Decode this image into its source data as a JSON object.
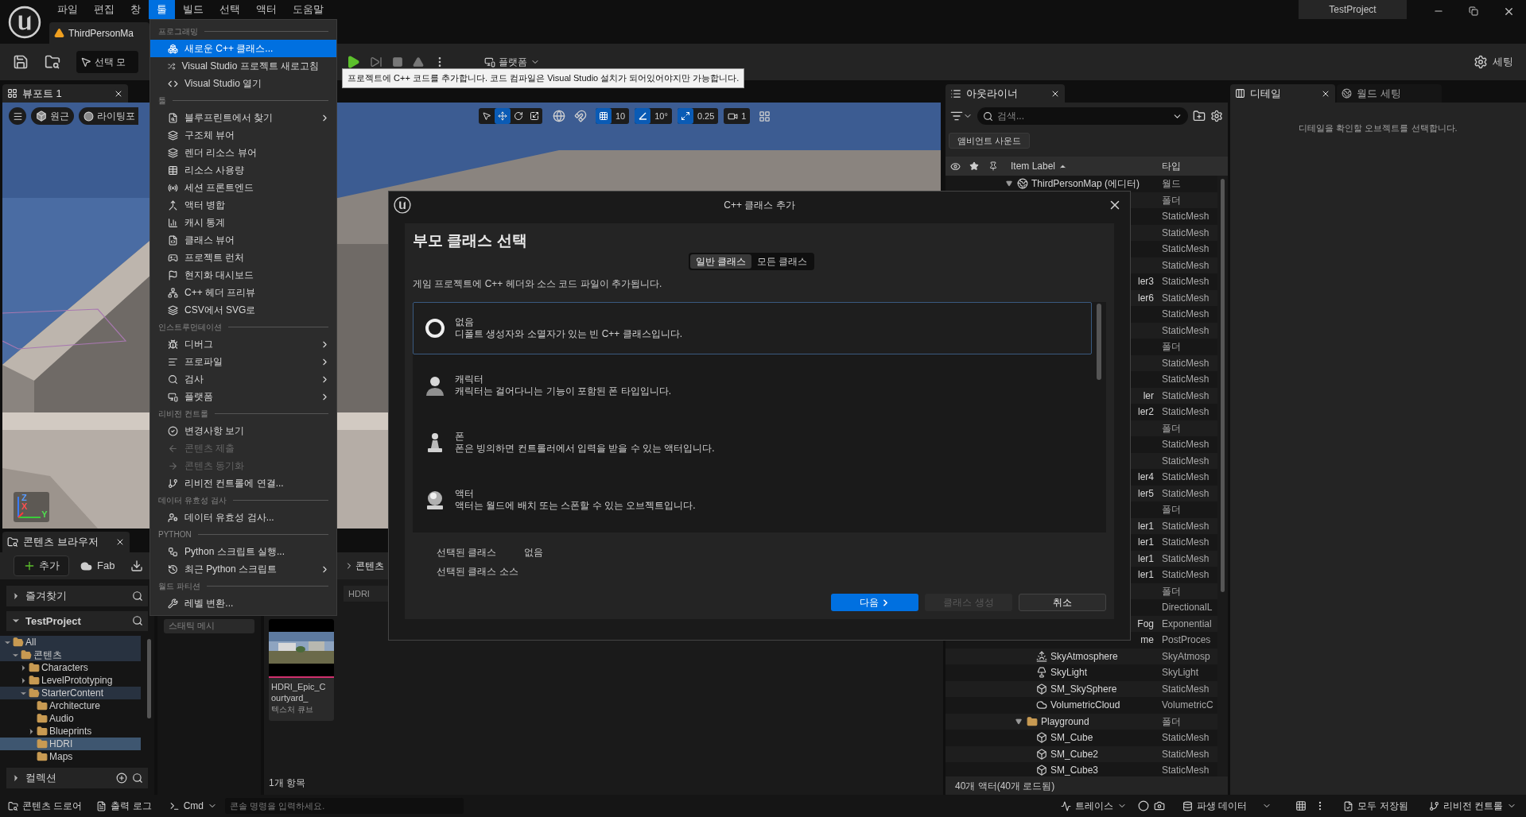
{
  "menu_bar": [
    {
      "label": "파일",
      "selected": false
    },
    {
      "label": "편집",
      "selected": false
    },
    {
      "label": "창",
      "selected": false
    },
    {
      "label": "툴",
      "selected": true
    },
    {
      "label": "빌드",
      "selected": false
    },
    {
      "label": "선택",
      "selected": false
    },
    {
      "label": "액터",
      "selected": false
    },
    {
      "label": "도움말",
      "selected": false
    }
  ],
  "document_tab": {
    "title": "ThirdPersonMa"
  },
  "project_name": "TestProject",
  "toolbar": {
    "mode_button": "선택 모",
    "platform_button": "플랫폼",
    "settings_button": "세팅"
  },
  "viewport": {
    "tab": "뷰포트 1",
    "view_mode": "원근",
    "lighting": "라이팅포",
    "transform_tools": [
      {
        "kind": "select",
        "selected": false
      },
      {
        "kind": "translate",
        "selected": true
      },
      {
        "kind": "rotate",
        "selected": false
      },
      {
        "kind": "scale",
        "selected": false
      }
    ],
    "grid_snap": {
      "value": "10",
      "on": true
    },
    "angle_snap": {
      "value": "10°",
      "on": true
    },
    "scale_snap": {
      "value": "0.25",
      "on": true
    },
    "camera_speed": "1",
    "axis_labels": [
      "Z",
      "X",
      "Y"
    ]
  },
  "tools_menu": [
    {
      "title": "프로그래밍",
      "items": [
        {
          "label": "새로운 C++ 클래스...",
          "selected": true,
          "submenu": false,
          "disabled": false
        },
        {
          "label": "Visual Studio 프로젝트 새로고침",
          "selected": false,
          "submenu": false,
          "disabled": false
        },
        {
          "label": "Visual Studio 열기",
          "selected": false,
          "submenu": false,
          "disabled": false
        }
      ]
    },
    {
      "title": "툴",
      "items": [
        {
          "label": "블루프린트에서 찾기",
          "selected": false,
          "submenu": true,
          "disabled": false
        },
        {
          "label": "구조체 뷰어",
          "selected": false,
          "submenu": false,
          "disabled": false
        },
        {
          "label": "렌더 리소스 뷰어",
          "selected": false,
          "submenu": false,
          "disabled": false
        },
        {
          "label": "리소스 사용량",
          "selected": false,
          "submenu": false,
          "disabled": false
        },
        {
          "label": "세션 프론트엔드",
          "selected": false,
          "submenu": false,
          "disabled": false
        },
        {
          "label": "액터 병합",
          "selected": false,
          "submenu": false,
          "disabled": false
        },
        {
          "label": "캐시 통계",
          "selected": false,
          "submenu": false,
          "disabled": false
        },
        {
          "label": "클래스 뷰어",
          "selected": false,
          "submenu": false,
          "disabled": false
        },
        {
          "label": "프로젝트 런처",
          "selected": false,
          "submenu": false,
          "disabled": false
        },
        {
          "label": "현지화 대시보드",
          "selected": false,
          "submenu": false,
          "disabled": false
        },
        {
          "label": "C++ 헤더 프리뷰",
          "selected": false,
          "submenu": false,
          "disabled": false
        },
        {
          "label": "CSV에서 SVG로",
          "selected": false,
          "submenu": false,
          "disabled": false
        }
      ]
    },
    {
      "title": "인스트루먼테이션",
      "items": [
        {
          "label": "디버그",
          "selected": false,
          "submenu": true,
          "disabled": false
        },
        {
          "label": "프로파일",
          "selected": false,
          "submenu": true,
          "disabled": false
        },
        {
          "label": "검사",
          "selected": false,
          "submenu": true,
          "disabled": false
        },
        {
          "label": "플랫폼",
          "selected": false,
          "submenu": true,
          "disabled": false
        }
      ]
    },
    {
      "title": "리비전 컨트롤",
      "items": [
        {
          "label": "변경사항 보기",
          "selected": false,
          "submenu": false,
          "disabled": false
        },
        {
          "label": "콘텐츠 제출",
          "selected": false,
          "submenu": false,
          "disabled": true
        },
        {
          "label": "콘텐츠 동기화",
          "selected": false,
          "submenu": false,
          "disabled": true
        },
        {
          "label": "리비전 컨트롤에 연결...",
          "selected": false,
          "submenu": false,
          "disabled": false
        }
      ]
    },
    {
      "title": "데이터 유효성 검사",
      "items": [
        {
          "label": "데이터 유효성 검사...",
          "selected": false,
          "submenu": false,
          "disabled": false
        }
      ]
    },
    {
      "title": "PYTHON",
      "items": [
        {
          "label": "Python 스크립트 실행...",
          "selected": false,
          "submenu": false,
          "disabled": false
        },
        {
          "label": "최근 Python 스크립트",
          "selected": false,
          "submenu": true,
          "disabled": false
        }
      ]
    },
    {
      "title": "월드 파티션",
      "items": [
        {
          "label": "레벨 변환...",
          "selected": false,
          "submenu": false,
          "disabled": false
        }
      ]
    }
  ],
  "tooltip": "프로젝트에 C++ 코드를 추가합니다. 코드 컴파일은 Visual Studio 설치가 되어있어야지만 가능합니다.",
  "content_browser": {
    "tab": "콘텐츠 브라우저",
    "add_button": "추가",
    "fab_button": "Fab",
    "breadcrumb": "콘텐츠",
    "path_segment": "HDRI",
    "favorites": {
      "label": "즐겨찾기",
      "expanded": false
    },
    "project": {
      "label": "TestProject",
      "expanded": true
    },
    "collections": {
      "label": "컬렉션",
      "expanded": false
    },
    "folders": [
      {
        "label": "All",
        "expanded": true,
        "selected": false,
        "on_path": true,
        "children": [
          {
            "label": "콘텐츠",
            "expanded": true,
            "selected": false,
            "on_path": true,
            "children": [
              {
                "label": "Characters",
                "expanded": false,
                "selected": false,
                "on_path": false
              },
              {
                "label": "LevelPrototyping",
                "expanded": false,
                "selected": false,
                "on_path": false
              },
              {
                "label": "StarterContent",
                "expanded": true,
                "selected": false,
                "on_path": true,
                "children": [
                  {
                    "label": "Architecture",
                    "selected": false,
                    "on_path": false
                  },
                  {
                    "label": "Audio",
                    "selected": false,
                    "on_path": false
                  },
                  {
                    "label": "Blueprints",
                    "expanded": false,
                    "selected": false,
                    "on_path": false
                  },
                  {
                    "label": "HDRI",
                    "selected": true,
                    "on_path": false
                  },
                  {
                    "label": "Maps",
                    "selected": false,
                    "on_path": false
                  }
                ]
              }
            ]
          }
        ]
      }
    ],
    "filter_chip": "스태틱 메시",
    "assets": [
      {
        "name": "HDRI_Epic_Courtyard_",
        "type": "텍스처 큐브"
      }
    ],
    "item_count": "1개 항목"
  },
  "outliner": {
    "tab": "아웃라이너",
    "search_placeholder": "검색...",
    "ambient_button": "앰비언트 사운드",
    "columns": [
      "Item Label",
      "타입"
    ],
    "rows": [
      {
        "label": "ThirdPersonMap (에디터)",
        "kind": "world",
        "type": "월드",
        "expanded": true,
        "children": [
          {
            "type": "폴더",
            "children": [
              {
                "type": "StaticMesh"
              },
              {
                "type": "StaticMesh"
              },
              {
                "type": "StaticMesh"
              },
              {
                "type": "StaticMesh"
              },
              {
                "label_tail": "ler3",
                "type": "StaticMesh"
              },
              {
                "label_tail": "ler6",
                "type": "StaticMesh"
              },
              {
                "type": "StaticMesh"
              },
              {
                "type": "StaticMesh"
              }
            ]
          },
          {
            "type": "폴더",
            "children": [
              {
                "type": "StaticMesh"
              },
              {
                "type": "StaticMesh"
              },
              {
                "label_tail": "ler",
                "type": "StaticMesh"
              },
              {
                "label_tail": "ler2",
                "type": "StaticMesh"
              }
            ]
          },
          {
            "type": "폴더",
            "children": [
              {
                "type": "StaticMesh"
              },
              {
                "type": "StaticMesh"
              },
              {
                "label_tail": "ler4",
                "type": "StaticMesh"
              },
              {
                "label_tail": "ler5",
                "type": "StaticMesh"
              }
            ]
          },
          {
            "type": "폴더",
            "children": [
              {
                "label_tail": "ler1",
                "type": "StaticMesh"
              },
              {
                "label_tail": "ler1",
                "type": "StaticMesh"
              },
              {
                "label_tail": "ler1",
                "type": "StaticMesh"
              },
              {
                "label_tail": "ler1",
                "type": "StaticMesh"
              }
            ]
          },
          {
            "type": "폴더",
            "children": [
              {
                "type": "DirectionalL"
              },
              {
                "label_tail": "Fog",
                "type": "Exponential"
              },
              {
                "label_tail": "me",
                "type": "PostProces"
              },
              {
                "label": "SkyAtmosphere",
                "kind": "sky_atmosphere",
                "type": "SkyAtmosp"
              },
              {
                "label": "SkyLight",
                "kind": "sky_light",
                "type": "SkyLight"
              },
              {
                "label": "SM_SkySphere",
                "kind": "static_mesh",
                "type": "StaticMesh"
              },
              {
                "label": "VolumetricCloud",
                "kind": "volumetric_cloud",
                "type": "VolumetricC"
              }
            ]
          },
          {
            "label": "Playground",
            "kind": "folder",
            "type": "폴더",
            "expanded": true,
            "children": [
              {
                "label": "SM_Cube",
                "kind": "static_mesh",
                "type": "StaticMesh"
              },
              {
                "label": "SM_Cube2",
                "kind": "static_mesh",
                "type": "StaticMesh"
              },
              {
                "label": "SM_Cube3",
                "kind": "static_mesh",
                "type": "StaticMesh"
              }
            ]
          }
        ]
      }
    ],
    "count": "40개 액터(40개 로드됨)"
  },
  "details": {
    "tabs": [
      {
        "label": "디테일",
        "selected": true
      },
      {
        "label": "월드 세팅",
        "selected": false
      }
    ],
    "empty_message": "디테일을 확인할 오브젝트를 선택합니다."
  },
  "dialog": {
    "title": "C++ 클래스 추가",
    "heading": "부모 클래스 선택",
    "tabs": [
      {
        "label": "일반 클래스",
        "selected": true
      },
      {
        "label": "모든 클래스",
        "selected": false
      }
    ],
    "description": "게임 프로젝트에 C++ 헤더와 소스 코드 파일이 추가됩니다.",
    "classes": [
      {
        "kind": "none",
        "name": "없음",
        "description": "디폴트 생성자와 소멸자가 있는 빈 C++ 클래스입니다.",
        "selected": true
      },
      {
        "kind": "character",
        "name": "캐릭터",
        "description": "캐릭터는 걸어다니는 기능이 포함된 폰 타입입니다.",
        "selected": false
      },
      {
        "kind": "pawn",
        "name": "폰",
        "description": "폰은 빙의하면 컨트롤러에서 입력을 받을 수 있는 액터입니다.",
        "selected": false
      },
      {
        "kind": "actor",
        "name": "액터",
        "description": "액터는 월드에 배치 또는 스폰할 수 있는 오브젝트입니다.",
        "selected": false
      }
    ],
    "selected_class_label": "선택된 클래스",
    "selected_class_value": "없음",
    "selected_source_label": "선택된 클래스 소스",
    "buttons": [
      {
        "label": "다음",
        "kind": "primary",
        "disabled": false
      },
      {
        "label": "클래스 생성",
        "kind": "secondary",
        "disabled": true
      },
      {
        "label": "취소",
        "kind": "secondary",
        "disabled": false
      }
    ]
  },
  "status_bar": {
    "content_drawer": "콘텐츠 드로어",
    "output_log": "출력 로그",
    "cmd": "Cmd",
    "console_placeholder": "콘솔 명령을 입력하세요.",
    "trace": "트레이스",
    "derived_data": "파생 데이터",
    "save_status": "모두 저장됨",
    "revision_control": "리비전 컨트롤"
  }
}
